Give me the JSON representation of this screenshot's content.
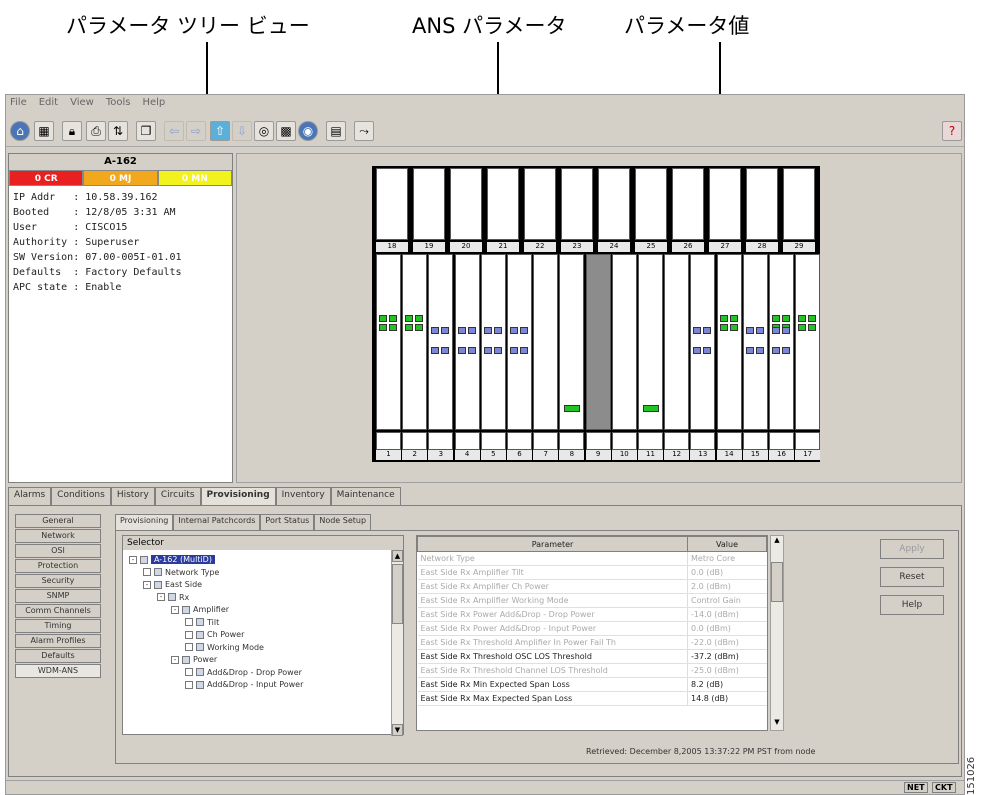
{
  "callouts": {
    "tree_view": "パラメータ ツリー ビュー",
    "ans_params": "ANS パラメータ",
    "param_value": "パラメータ値"
  },
  "figure_id": "151026",
  "menu": [
    "File",
    "Edit",
    "View",
    "Tools",
    "Help"
  ],
  "toolbar_icons": [
    "home-icon",
    "network-icon",
    "lock-icon",
    "print-icon",
    "export-icon",
    "window-icon",
    "back-icon",
    "forward-icon",
    "up-icon",
    "down-icon",
    "globe-icon",
    "grid-icon",
    "network-view-icon",
    "card-icon",
    "link-icon",
    "help-icon"
  ],
  "node": {
    "name": "A-162",
    "alarms": [
      {
        "label": "0 CR",
        "color": "#e82020",
        "text_color": "#ffffff"
      },
      {
        "label": "0 MJ",
        "color": "#f2a81c",
        "text_color": "#ffffff"
      },
      {
        "label": "0 MN",
        "color": "#f2f21c",
        "text_color": "#ffffff"
      }
    ],
    "info": [
      "IP Addr   : 10.58.39.162",
      "Booted    : 12/8/05 3:31 AM",
      "User      : CISCO15",
      "Authority : Superuser",
      "SW Version: 07.00-005I-01.01",
      "Defaults  : Factory Defaults",
      "APC state : Enable"
    ]
  },
  "shelf": {
    "top_slots": [
      "18",
      "19",
      "20",
      "21",
      "22",
      "23",
      "24",
      "25",
      "26",
      "27",
      "28",
      "29"
    ],
    "bottom_slots": [
      "1",
      "2",
      "3",
      "4",
      "5",
      "6",
      "7",
      "8",
      "9",
      "10",
      "11",
      "12",
      "13",
      "14",
      "15",
      "16",
      "17"
    ]
  },
  "tabs": [
    "Alarms",
    "Conditions",
    "History",
    "Circuits",
    "Provisioning",
    "Inventory",
    "Maintenance"
  ],
  "active_tab": "Provisioning",
  "leftnav": [
    "General",
    "Network",
    "OSI",
    "Protection",
    "Security",
    "SNMP",
    "Comm Channels",
    "Timing",
    "Alarm Profiles",
    "Defaults",
    "WDM-ANS"
  ],
  "leftnav_selected": "WDM-ANS",
  "subtabs": [
    "Provisioning",
    "Internal Patchcords",
    "Port Status",
    "Node Setup"
  ],
  "selector_label": "Selector",
  "tree": [
    {
      "label": "A-162 (MultiD)",
      "depth": 0,
      "selected": true,
      "expander": "-"
    },
    {
      "label": "Network Type",
      "depth": 1
    },
    {
      "label": "East Side",
      "depth": 1,
      "expander": "-"
    },
    {
      "label": "Rx",
      "depth": 2,
      "expander": "-"
    },
    {
      "label": "Amplifier",
      "depth": 3,
      "expander": "-"
    },
    {
      "label": "Tilt",
      "depth": 4
    },
    {
      "label": "Ch Power",
      "depth": 4
    },
    {
      "label": "Working Mode",
      "depth": 4
    },
    {
      "label": "Power",
      "depth": 3,
      "expander": "-"
    },
    {
      "label": "Add&Drop - Drop Power",
      "depth": 4
    },
    {
      "label": "Add&Drop - Input Power",
      "depth": 4
    }
  ],
  "table": {
    "headers": [
      "Parameter",
      "Value"
    ],
    "rows": [
      {
        "param": "Network Type",
        "value": "Metro Core",
        "editable": false
      },
      {
        "param": "East Side Rx Amplifier Tilt",
        "value": "0.0   (dB)",
        "editable": false
      },
      {
        "param": "East Side Rx Amplifier Ch Power",
        "value": "2.0   (dBm)",
        "editable": false
      },
      {
        "param": "East Side Rx Amplifier Working Mode",
        "value": "Control Gain",
        "editable": false
      },
      {
        "param": "East Side Rx Power Add&Drop - Drop Power",
        "value": "-14.0   (dBm)",
        "editable": false
      },
      {
        "param": "East Side Rx Power Add&Drop - Input Power",
        "value": "0.0   (dBm)",
        "editable": false
      },
      {
        "param": "East Side Rx Threshold Amplifier In Power Fail Th",
        "value": "-22.0   (dBm)",
        "editable": false
      },
      {
        "param": "East Side Rx Threshold OSC LOS Threshold",
        "value": "-37.2   (dBm)",
        "editable": true
      },
      {
        "param": "East Side Rx Threshold Channel LOS Threshold",
        "value": "-25.0   (dBm)",
        "editable": false
      },
      {
        "param": "East Side Rx Min Expected Span Loss",
        "value": "8.2   (dB)",
        "editable": true
      },
      {
        "param": "East Side Rx Max Expected Span Loss",
        "value": "14.8   (dB)",
        "editable": true
      }
    ]
  },
  "buttons": {
    "apply": "Apply",
    "reset": "Reset",
    "help": "Help"
  },
  "status_message": "Retrieved: December 8,2005 13:37:22 PM PST from node",
  "statusbar": {
    "net": "NET",
    "ckt": "CKT"
  }
}
